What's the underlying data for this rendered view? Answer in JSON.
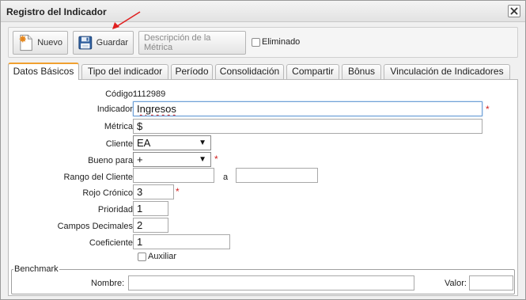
{
  "window": {
    "title": "Registro del Indicador",
    "close_icon": "close-icon"
  },
  "toolbar": {
    "nuevo_label": "Nuevo",
    "guardar_label": "Guardar",
    "descripcion_label": "Descripción de la Métrica",
    "eliminado_label": "Eliminado",
    "eliminado_checked": false
  },
  "tabs": [
    {
      "label": "Datos Básicos",
      "active": true
    },
    {
      "label": "Tipo del indicador",
      "active": false
    },
    {
      "label": "Período",
      "active": false
    },
    {
      "label": "Consolidación",
      "active": false
    },
    {
      "label": "Compartir",
      "active": false
    },
    {
      "label": "Bônus",
      "active": false
    },
    {
      "label": "Vinculación de Indicadores",
      "active": false
    }
  ],
  "form": {
    "codigo_label": "Código:",
    "codigo_value": "1112989",
    "indicador_label": "Indicador:",
    "indicador_value": "Ingresos",
    "metrica_label": "Métrica:",
    "metrica_value": "$",
    "cliente_label": "Cliente:",
    "cliente_value": "EA",
    "bueno_label": "Bueno para:",
    "bueno_value": "+",
    "rango_label": "Rango del Cliente:",
    "rango_from": "",
    "rango_sep": "a",
    "rango_to": "",
    "rojo_label": "Rojo Crónico:",
    "rojo_value": "3",
    "prioridad_label": "Prioridad:",
    "prioridad_value": "1",
    "campos_label": "Campos Decimales:",
    "campos_value": "2",
    "coef_label": "Coeficiente:",
    "coef_value": "1",
    "auxiliar_label": "Auxiliar",
    "auxiliar_checked": false,
    "required_mark": "*"
  },
  "benchmark": {
    "legend": "Benchmark",
    "nombre_label": "Nombre:",
    "nombre_value": "",
    "valor_label": "Valor:",
    "valor_value": ""
  },
  "colors": {
    "accent_tab": "#f0a030",
    "required": "#d02020",
    "annotation_arrow": "#e02020"
  }
}
